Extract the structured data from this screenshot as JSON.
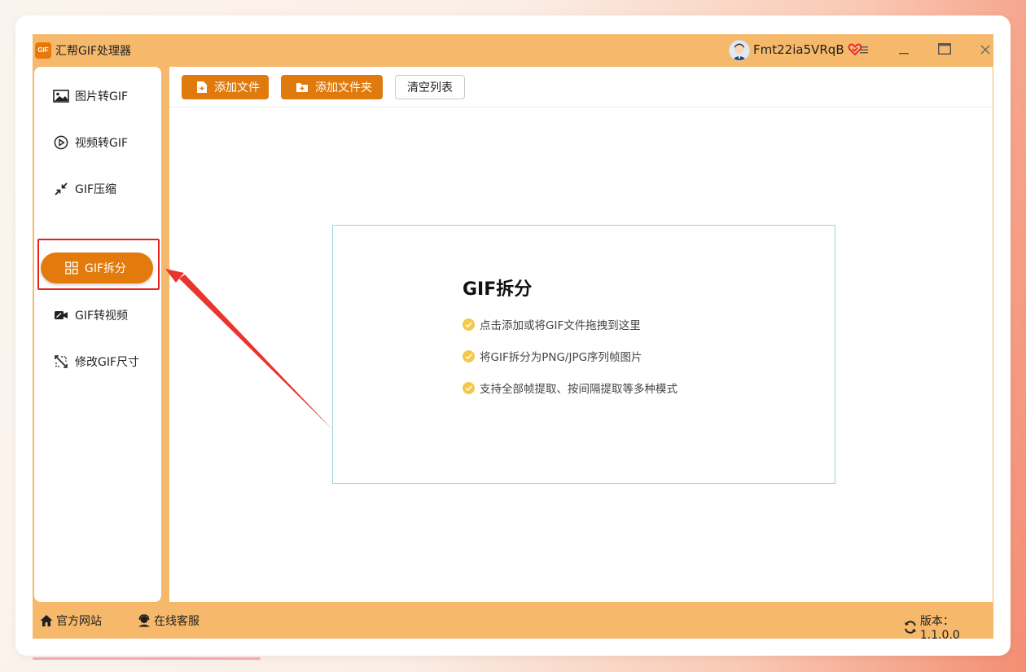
{
  "window": {
    "title": "汇帮GIF处理器",
    "logo_text": "GIF",
    "username": "Fmt22ia5VRqB",
    "controls": [
      "—",
      "☐",
      "×"
    ]
  },
  "sidebar": {
    "items": [
      {
        "label": "图片转GIF",
        "icon": "image-icon",
        "active": false
      },
      {
        "label": "视频转GIF",
        "icon": "play-icon",
        "active": false
      },
      {
        "label": "GIF压缩",
        "icon": "compress-icon",
        "active": false
      },
      {
        "label": "GIF拆分",
        "icon": "grid-icon",
        "active": true
      },
      {
        "label": "GIF转视频",
        "icon": "video-icon",
        "active": false
      },
      {
        "label": "修改GIF尺寸",
        "icon": "resize-icon",
        "active": false
      }
    ]
  },
  "toolbar": {
    "add_file": "添加文件",
    "add_folder": "添加文件夹",
    "clear_list": "清空列表"
  },
  "drop_zone": {
    "title": "GIF拆分",
    "items": [
      "点击添加或将GIF文件拖拽到这里",
      "将GIF拆分为PNG/JPG序列帧图片",
      "支持全部帧提取、按间隔提取等多种模式"
    ]
  },
  "statusbar": {
    "website": "官方网站",
    "support": "在线客服",
    "version": "版本：1.1.0.0"
  },
  "colors": {
    "accent": "#e37b0c",
    "frame": "#f6b86a",
    "highlight": "#e52222",
    "check": "#f5c84c"
  }
}
